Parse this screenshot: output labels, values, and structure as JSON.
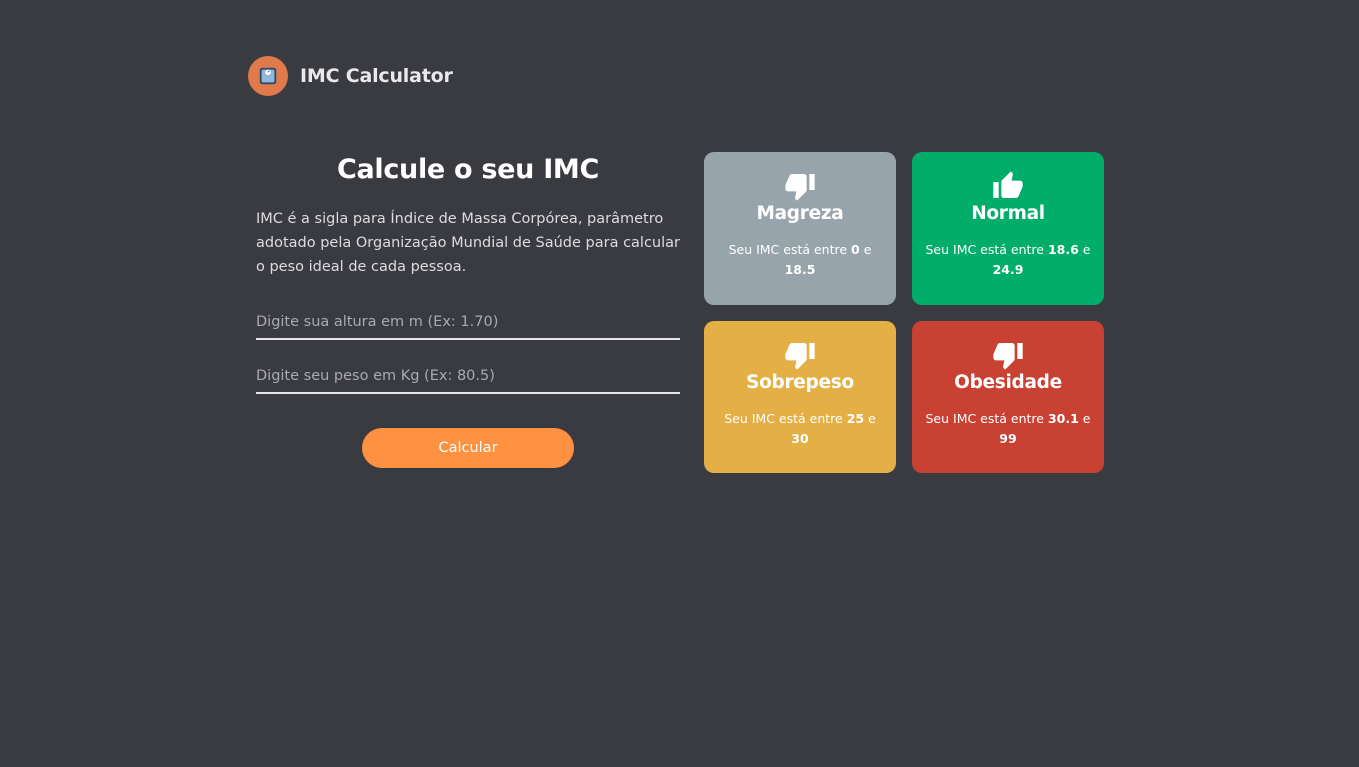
{
  "header": {
    "app_title": "IMC Calculator",
    "logo_icon": "scale-icon"
  },
  "main": {
    "title": "Calcule o seu IMC",
    "description": "IMC é a sigla para Índice de Massa Corpórea, parâmetro adotado pela Organização Mundial de Saúde para calcular o peso ideal de cada pessoa.",
    "height_input": {
      "value": "",
      "placeholder": "Digite sua altura em m (Ex: 1.70)"
    },
    "weight_input": {
      "value": "",
      "placeholder": "Digite seu peso em Kg (Ex: 80.5)"
    },
    "calculate_label": "Calcular"
  },
  "cards": {
    "magreza": {
      "title": "Magreza",
      "range_prefix": "Seu IMC está entre",
      "min": "0",
      "connector": "e",
      "max": "18.5",
      "color": "#97a4ab",
      "icon": "thumbs-down-icon"
    },
    "normal": {
      "title": "Normal",
      "range_prefix": "Seu IMC está entre",
      "min": "18.6",
      "connector": "e",
      "max": "24.9",
      "color": "#00ae6a",
      "icon": "thumbs-up-icon"
    },
    "sobrepeso": {
      "title": "Sobrepeso",
      "range_prefix": "Seu IMC está entre",
      "min": "25",
      "connector": "e",
      "max": "30",
      "color": "#e4af45",
      "icon": "thumbs-down-icon"
    },
    "obesidade": {
      "title": "Obesidade",
      "range_prefix": "Seu IMC está entre",
      "min": "30.1",
      "connector": "e",
      "max": "99",
      "color": "#c84133",
      "icon": "thumbs-down-icon"
    }
  },
  "colors": {
    "background": "#3a3b40",
    "accent": "#ff9142",
    "logo": "#e07a4a"
  }
}
